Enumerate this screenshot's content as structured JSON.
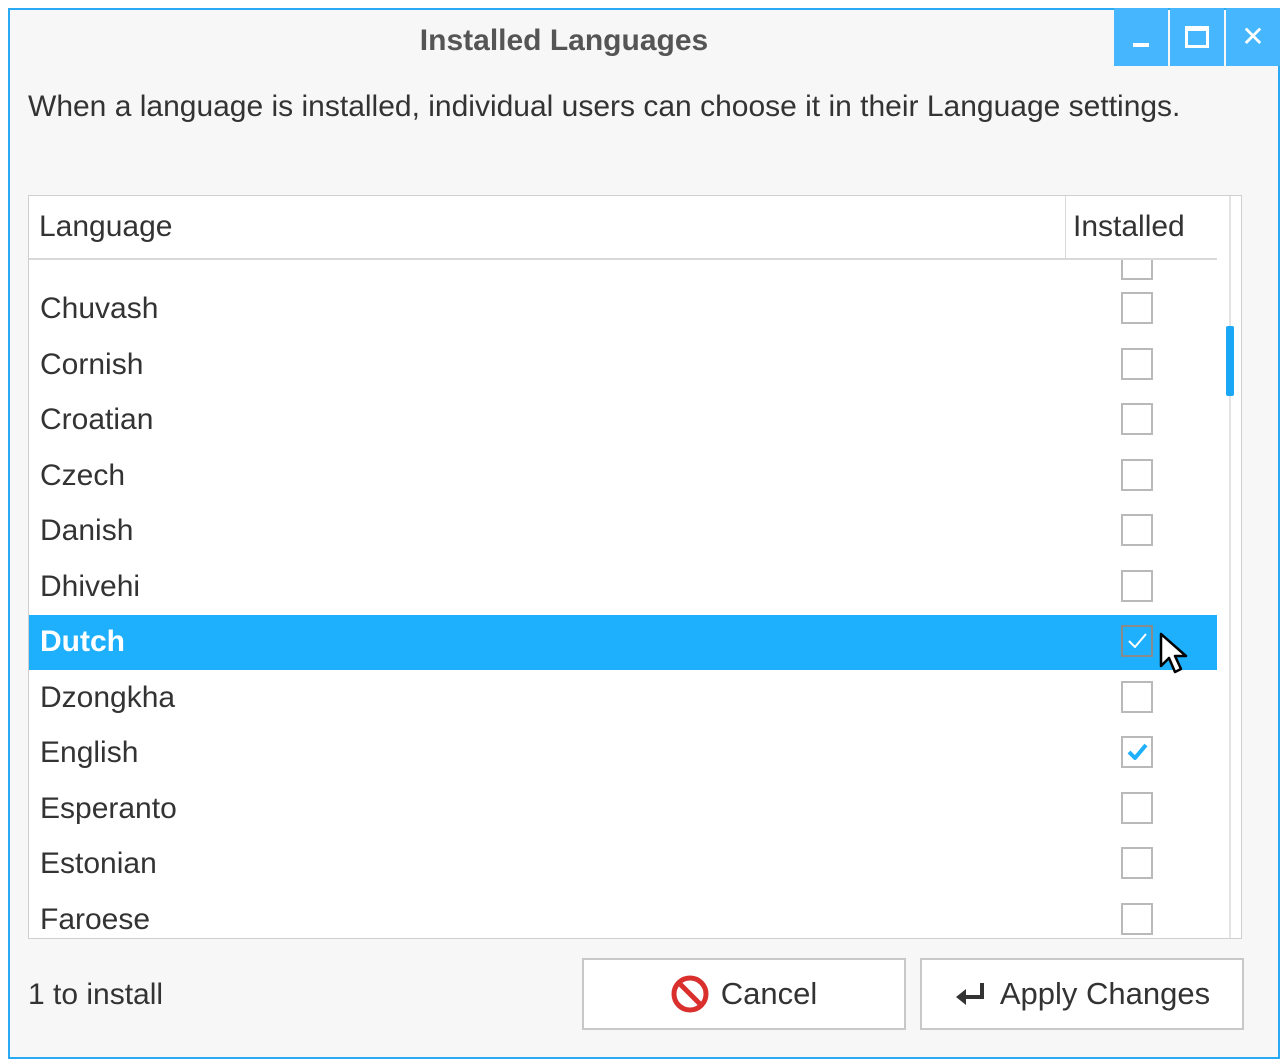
{
  "window": {
    "title": "Installed Languages",
    "buttons": {
      "minimize": "minimize-icon",
      "maximize": "maximize-icon",
      "close": "close-icon"
    }
  },
  "description": "When a language is installed, individual users can choose it in their Language settings.",
  "table": {
    "columns": {
      "language": "Language",
      "installed": "Installed"
    },
    "rows": [
      {
        "language": "Chuvash",
        "installed": false,
        "selected": false
      },
      {
        "language": "Cornish",
        "installed": false,
        "selected": false
      },
      {
        "language": "Croatian",
        "installed": false,
        "selected": false
      },
      {
        "language": "Czech",
        "installed": false,
        "selected": false
      },
      {
        "language": "Danish",
        "installed": false,
        "selected": false
      },
      {
        "language": "Dhivehi",
        "installed": false,
        "selected": false
      },
      {
        "language": "Dutch",
        "installed": true,
        "selected": true
      },
      {
        "language": "Dzongkha",
        "installed": false,
        "selected": false
      },
      {
        "language": "English",
        "installed": true,
        "selected": false
      },
      {
        "language": "Esperanto",
        "installed": false,
        "selected": false
      },
      {
        "language": "Estonian",
        "installed": false,
        "selected": false
      },
      {
        "language": "Faroese",
        "installed": false,
        "selected": false
      }
    ]
  },
  "status": "1 to install",
  "buttons": {
    "cancel": {
      "label": "Cancel",
      "icon": "stop-icon"
    },
    "apply": {
      "label": "Apply Changes",
      "icon": "enter-icon"
    }
  },
  "colors": {
    "accent": "#1eb0fc",
    "window_border": "#2aa9f5",
    "cancel_icon": "#d9302e"
  }
}
